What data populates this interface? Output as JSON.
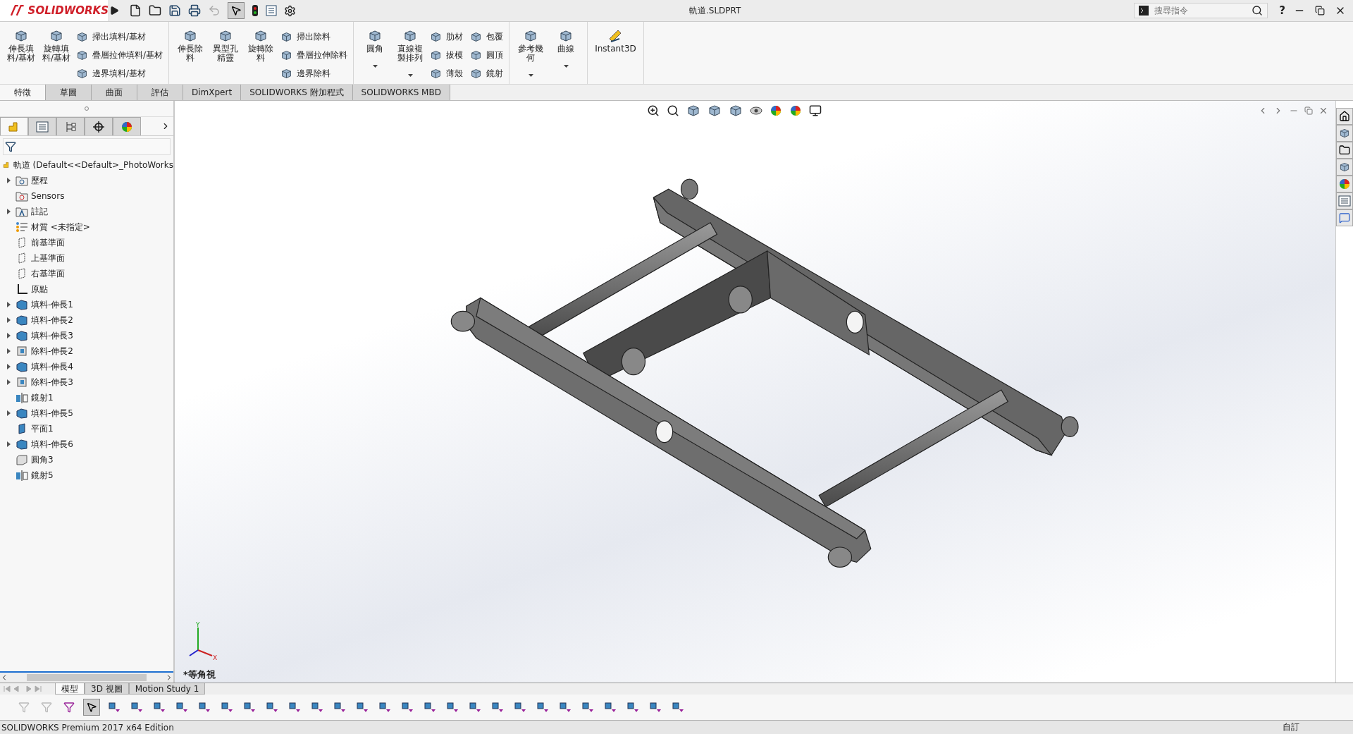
{
  "title_bar": {
    "logo": "SOLIDWORKS",
    "document": "軌道.SLDPRT",
    "search": {
      "placeholder": "搜尋指令"
    },
    "help": "?"
  },
  "ribbon": {
    "groups": [
      {
        "big": [
          {
            "lines": [
              "伸長填",
              "料/基材"
            ]
          },
          {
            "lines": [
              "旋轉填",
              "料/基材"
            ]
          }
        ],
        "small": [
          "掃出填料/基材",
          "疊層拉伸填料/基材",
          "邊界填料/基材"
        ]
      },
      {
        "big": [
          {
            "lines": [
              "伸長除",
              "料"
            ]
          },
          {
            "lines": [
              "異型孔",
              "精靈"
            ]
          },
          {
            "lines": [
              "旋轉除",
              "料"
            ]
          }
        ],
        "small": [
          "掃出除料",
          "疊層拉伸除料",
          "邊界除料"
        ]
      },
      {
        "big": [
          {
            "lines": [
              "圓角"
            ],
            "dropdown": true
          },
          {
            "lines": [
              "直線複",
              "製排列"
            ],
            "dropdown": true
          }
        ],
        "small": [
          "肋材",
          "拔模",
          "薄殼",
          "包覆",
          "圓頂",
          "鏡射"
        ]
      },
      {
        "big": [
          {
            "lines": [
              "參考幾",
              "何"
            ],
            "dropdown": true
          },
          {
            "lines": [
              "曲線"
            ],
            "dropdown": true
          }
        ]
      },
      {
        "big": [
          {
            "lines": [
              "Instant3D"
            ],
            "dropdown": false
          }
        ]
      }
    ]
  },
  "tabs": [
    {
      "label": "特徵",
      "selected": true
    },
    {
      "label": "草圖",
      "selected": false
    },
    {
      "label": "曲面",
      "selected": false
    },
    {
      "label": "評估",
      "selected": false
    },
    {
      "label": "DimXpert",
      "selected": false
    },
    {
      "label": "SOLIDWORKS 附加程式",
      "selected": false
    },
    {
      "label": "SOLIDWORKS MBD",
      "selected": false
    }
  ],
  "panel_tabs": [
    {
      "kind": "part",
      "selected": true
    },
    {
      "kind": "list",
      "selected": false
    },
    {
      "kind": "config",
      "selected": false
    },
    {
      "kind": "target",
      "selected": false
    },
    {
      "kind": "appearance",
      "selected": false
    }
  ],
  "tree": {
    "root": {
      "kind": "part",
      "label": "軌道  (Default<<Default>_PhotoWorks"
    },
    "items": [
      {
        "kind": "history",
        "label": "歷程",
        "expandable": true
      },
      {
        "kind": "sensors",
        "label": "Sensors",
        "expandable": false
      },
      {
        "kind": "annotations",
        "label": "註記",
        "expandable": true
      },
      {
        "kind": "material",
        "label": "材質 <未指定>",
        "expandable": false
      },
      {
        "kind": "plane",
        "label": "前基準面",
        "expandable": false
      },
      {
        "kind": "plane",
        "label": "上基準面",
        "expandable": false
      },
      {
        "kind": "plane",
        "label": "右基準面",
        "expandable": false
      },
      {
        "kind": "origin",
        "label": "原點",
        "expandable": false
      },
      {
        "kind": "boss",
        "label": "填料-伸長1",
        "expandable": true
      },
      {
        "kind": "boss",
        "label": "填料-伸長2",
        "expandable": true
      },
      {
        "kind": "boss",
        "label": "填料-伸長3",
        "expandable": true
      },
      {
        "kind": "cut",
        "label": "除料-伸長2",
        "expandable": true
      },
      {
        "kind": "boss",
        "label": "填料-伸長4",
        "expandable": true
      },
      {
        "kind": "cut",
        "label": "除料-伸長3",
        "expandable": true
      },
      {
        "kind": "mirror",
        "label": "鏡射1",
        "expandable": false
      },
      {
        "kind": "boss",
        "label": "填料-伸長5",
        "expandable": true
      },
      {
        "kind": "refplane",
        "label": "平面1",
        "expandable": false
      },
      {
        "kind": "boss",
        "label": "填料-伸長6",
        "expandable": true
      },
      {
        "kind": "fillet",
        "label": "圓角3",
        "expandable": false
      },
      {
        "kind": "mirror",
        "label": "鏡射5",
        "expandable": false
      }
    ]
  },
  "viewport": {
    "view_name": "*等角視",
    "triad": [
      "Y",
      "X"
    ]
  },
  "bottom_tabs": [
    {
      "label": "模型",
      "selected": true
    },
    {
      "label": "3D 視圖",
      "selected": false
    },
    {
      "label": "Motion Study 1",
      "selected": false
    }
  ],
  "status_bar": {
    "edition": "SOLIDWORKS Premium 2017 x64 Edition",
    "units": "自訂"
  }
}
